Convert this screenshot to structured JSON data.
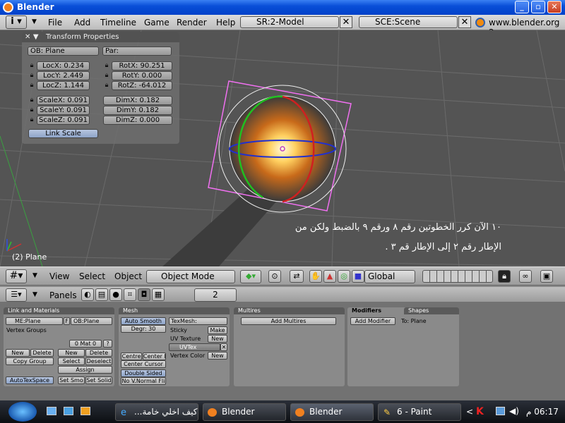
{
  "window": {
    "title": "Blender",
    "min": "_",
    "max": "▫",
    "close": "✕"
  },
  "menu": {
    "items": [
      "File",
      "Add",
      "Timeline",
      "Game",
      "Render",
      "Help"
    ],
    "screen_field": "SR:2-Model",
    "scene_field": "SCE:Scene",
    "website": "www.blender.org 2",
    "close_glyph": "✕"
  },
  "transform": {
    "title": "Transform Properties",
    "ob": "OB: Plane",
    "par": "Par:",
    "loc": [
      "LocX: 0.234",
      "LocY: 2.449",
      "LocZ: 1.144"
    ],
    "rot": [
      "RotX: 90.251",
      "RotY: 0.000",
      "RotZ: -64.012"
    ],
    "scale": [
      "ScaleX: 0.091",
      "ScaleY: 0.091",
      "ScaleZ: 0.091"
    ],
    "dim": [
      "DimX: 0.182",
      "DimY: 0.182",
      "DimZ: 0.000"
    ],
    "link_scale": "Link Scale"
  },
  "viewport": {
    "object_label": "(2) Plane",
    "annotation_line1": "١٠ الآن كرر الخطوتين رقم ٨ ورقم ٩ بالضبط ولكن من",
    "annotation_line2": "الإطار رقم ٢ إلى الإطار قم ٣ ."
  },
  "view_header": {
    "view": "View",
    "select": "Select",
    "object": "Object",
    "mode": "Object Mode",
    "orientation": "Global"
  },
  "buttons_header": {
    "panels": "Panels",
    "frame": "2"
  },
  "link_materials": {
    "title": "Link and Materials",
    "me": "ME:Plane",
    "f": "F",
    "ob": "OB:Plane",
    "vertex_groups": "Vertex Groups",
    "mat": "0 Mat 0",
    "q": "?",
    "new": "New",
    "delete": "Delete",
    "copy_group": "Copy Group",
    "new2": "New",
    "delete2": "Delete",
    "select": "Select",
    "deselect": "Deselect",
    "assign": "Assign",
    "autotexspace": "AutoTexSpace",
    "set_smo": "Set Smo",
    "set_solid": "Set Solid"
  },
  "mesh": {
    "title": "Mesh",
    "auto_smooth": "Auto Smooth",
    "degr": "Degr: 30",
    "centre": "Centre",
    "centre_new": "Center Ne",
    "centre_cursor": "Center Cursor",
    "double_sided": "Double Sided",
    "no_vnormal": "No V.Normal Fli",
    "texmesh": "TexMesh:",
    "sticky": "Sticky",
    "make": "Make",
    "uv_texture": "UV Texture",
    "new": "New",
    "uvtex": "UVTex",
    "vertex_color": "Vertex Color",
    "new2": "New"
  },
  "multires": {
    "title": "Multires",
    "add": "Add Multires"
  },
  "modifiers": {
    "tab1": "Modifiers",
    "tab2": "Shapes",
    "add": "Add Modifier",
    "to": "To: Plane"
  },
  "taskbar": {
    "tasks": [
      "...كيف اخلي خامة",
      "Blender",
      "Blender",
      "6 - Paint"
    ],
    "clock": "06:17 م",
    "chevron": "<"
  }
}
